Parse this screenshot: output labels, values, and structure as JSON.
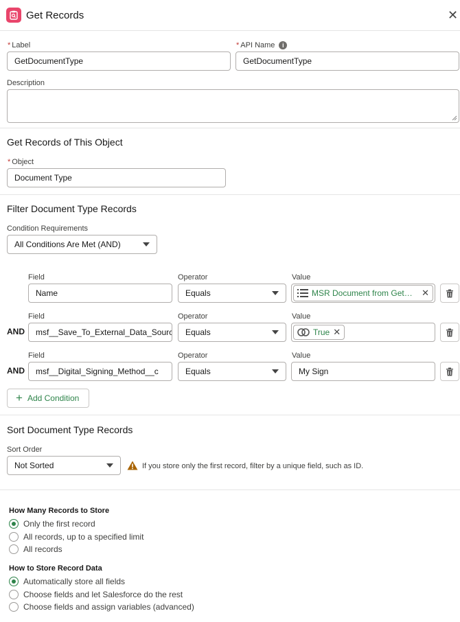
{
  "header": {
    "title": "Get Records",
    "close_icon": "close-icon"
  },
  "fields": {
    "label": {
      "label": "Label",
      "value": "GetDocumentType"
    },
    "api_name": {
      "label": "API Name",
      "value": "GetDocumentType"
    },
    "description": {
      "label": "Description",
      "value": ""
    }
  },
  "object_section": {
    "title": "Get Records of This Object",
    "object_label": "Object",
    "object_value": "Document Type"
  },
  "filter_section": {
    "title": "Filter Document Type Records",
    "condition_label": "Condition Requirements",
    "condition_value": "All Conditions Are Met (AND)",
    "rows": [
      {
        "connector": "",
        "field_label": "Field",
        "field": "Name",
        "operator_label": "Operator",
        "operator": "Equals",
        "value_label": "Value",
        "value": "MSR Document from GetDocu..."
      },
      {
        "connector": "AND",
        "field_label": "Field",
        "field": "msf__Save_To_External_Data_Sourc",
        "operator_label": "Operator",
        "operator": "Equals",
        "value_label": "Value",
        "value": "True"
      },
      {
        "connector": "AND",
        "field_label": "Field",
        "field": "msf__Digital_Signing_Method__c",
        "operator_label": "Operator",
        "operator": "Equals",
        "value_label": "Value",
        "value": "My Sign"
      }
    ],
    "add_condition": "Add Condition"
  },
  "sort_section": {
    "title": "Sort Document Type Records",
    "sort_label": "Sort Order",
    "sort_value": "Not Sorted",
    "warning": "If you store only the first record, filter by a unique field, such as ID."
  },
  "store_count": {
    "title": "How Many Records to Store",
    "options": [
      "Only the first record",
      "All records, up to a specified limit",
      "All records"
    ],
    "selected": "Only the first record"
  },
  "store_data": {
    "title": "How to Store Record Data",
    "options": [
      "Automatically store all fields",
      "Choose fields and let Salesforce do the rest",
      "Choose fields and assign variables (advanced)"
    ],
    "selected": "Automatically store all fields"
  },
  "colors": {
    "accent_green": "#2e844a",
    "icon_pink": "#e9456b",
    "required_red": "#c23934"
  }
}
